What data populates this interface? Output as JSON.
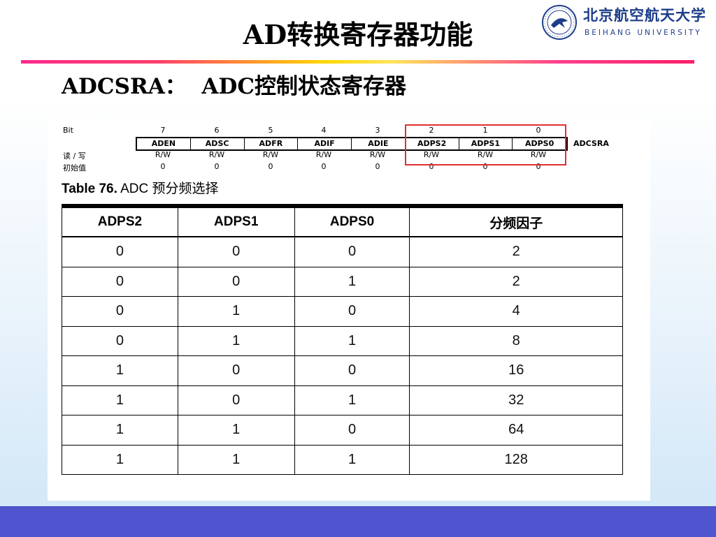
{
  "slide": {
    "title": "AD转换寄存器功能",
    "subtitle": "ADCSRA：  ADC控制状态寄存器"
  },
  "logo": {
    "name_cn": "北京航空航天大学",
    "name_en": "BEIHANG UNIVERSITY"
  },
  "register": {
    "bit_label": "Bit",
    "rw_label": "读 / 写",
    "init_label": "初始值",
    "name": "ADCSRA",
    "bit_numbers": [
      "7",
      "6",
      "5",
      "4",
      "3",
      "2",
      "1",
      "0"
    ],
    "bit_names": [
      "ADEN",
      "ADSC",
      "ADFR",
      "ADIF",
      "ADIE",
      "ADPS2",
      "ADPS1",
      "ADPS0"
    ],
    "rw": [
      "R/W",
      "R/W",
      "R/W",
      "R/W",
      "R/W",
      "R/W",
      "R/W",
      "R/W"
    ],
    "initial": [
      "0",
      "0",
      "0",
      "0",
      "0",
      "0",
      "0",
      "0"
    ],
    "highlight_color": "#e03030"
  },
  "table": {
    "caption_bold": "Table 76.",
    "caption_rest": " ADC 预分频选择",
    "headers": [
      "ADPS2",
      "ADPS1",
      "ADPS0",
      "分频因子"
    ],
    "rows": [
      [
        "0",
        "0",
        "0",
        "2"
      ],
      [
        "0",
        "0",
        "1",
        "2"
      ],
      [
        "0",
        "1",
        "0",
        "4"
      ],
      [
        "0",
        "1",
        "1",
        "8"
      ],
      [
        "1",
        "0",
        "0",
        "16"
      ],
      [
        "1",
        "0",
        "1",
        "32"
      ],
      [
        "1",
        "1",
        "0",
        "64"
      ],
      [
        "1",
        "1",
        "1",
        "128"
      ]
    ]
  },
  "colors": {
    "footer": "#4f55cf",
    "logo_blue": "#1d3d8a"
  }
}
